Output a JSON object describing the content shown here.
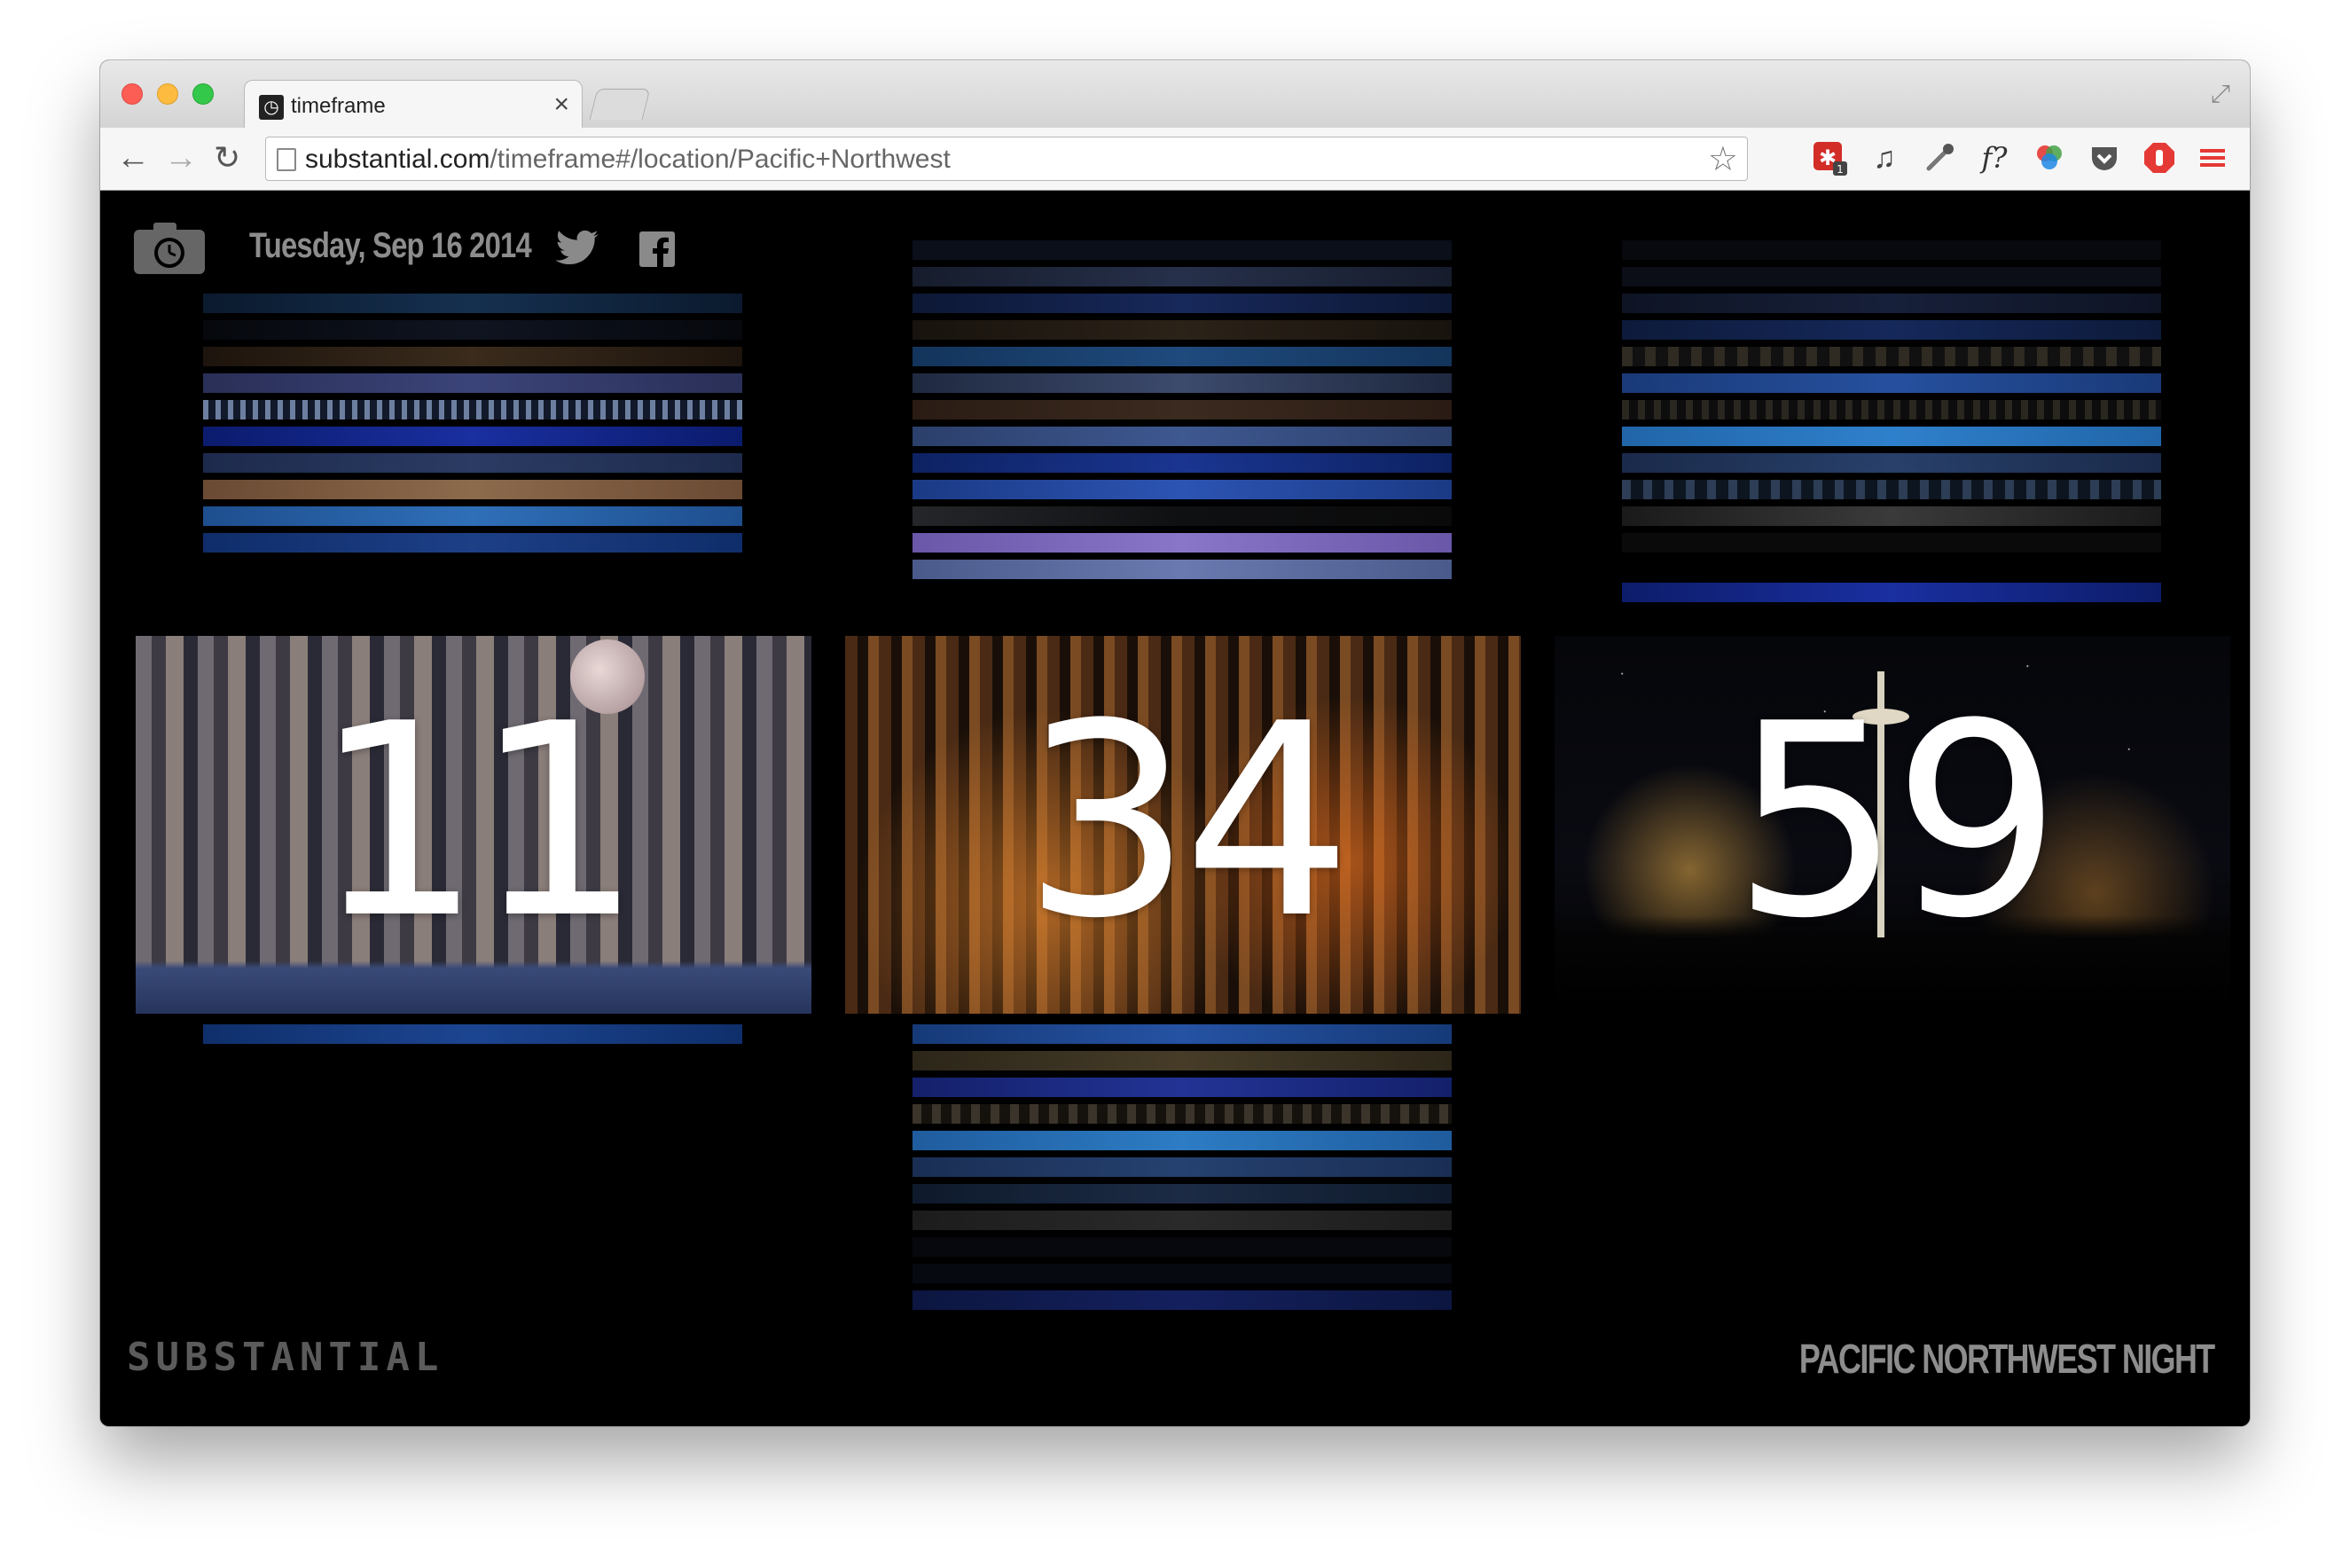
{
  "browser": {
    "tab_title": "timeframe",
    "tab_close": "×",
    "url_host": "substantial.com",
    "url_path": "/timeframe#/location/Pacific+Northwest",
    "extensions": [
      "lastpass-icon",
      "music-icon",
      "eyedropper-icon",
      "font-icon",
      "color-icon",
      "pocket-icon",
      "adblock-icon",
      "menu-icon"
    ],
    "extension_font_label": "f?",
    "lastpass_badge": "1"
  },
  "page": {
    "date": "Tuesday, Sep 16 2014",
    "clock": {
      "hours": "11",
      "minutes": "34",
      "seconds": "59"
    },
    "brand": "SUBSTANTIAL",
    "collection": "PACIFIC NORTHWEST NIGHT"
  },
  "colors": {
    "page_bg": "#000000",
    "text_muted": "#8d8d8d",
    "digits": "#ffffff"
  }
}
